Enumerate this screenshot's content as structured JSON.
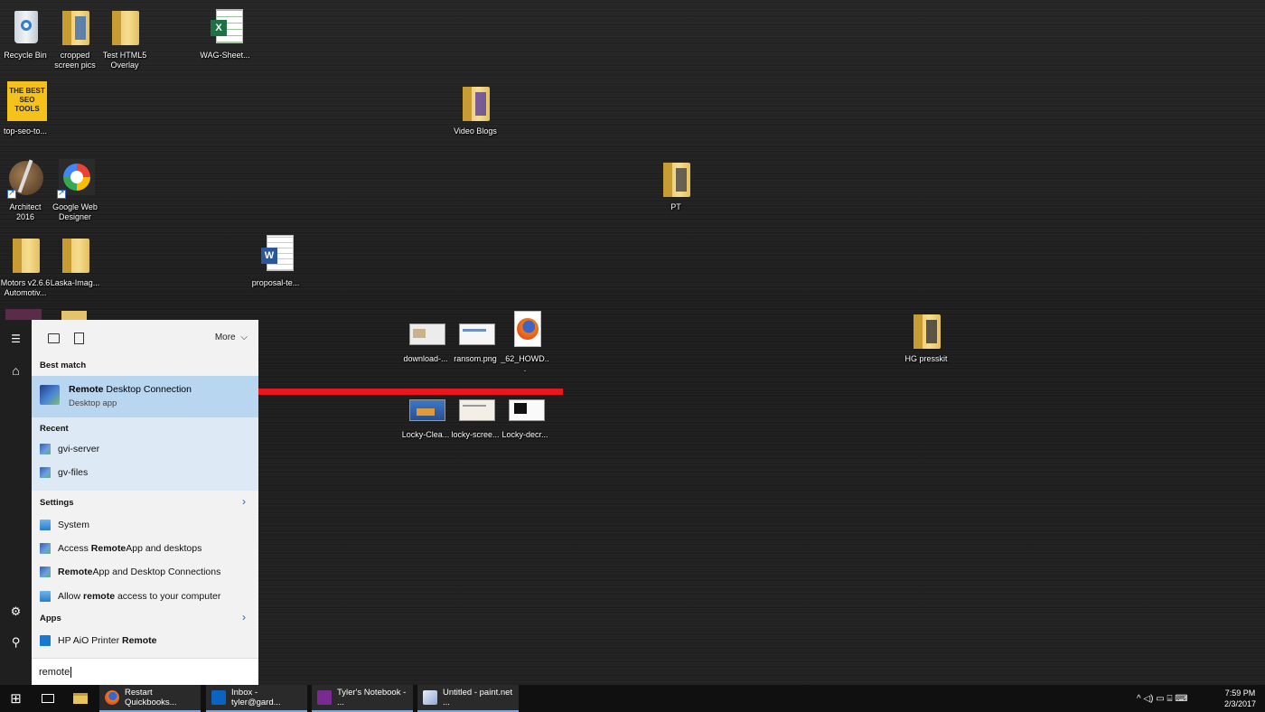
{
  "desktop": {
    "icons": [
      {
        "label": "Recycle Bin"
      },
      {
        "label": "cropped screen pics"
      },
      {
        "label": "Test HTML5 Overlay"
      },
      {
        "label": "WAG-Sheet..."
      },
      {
        "label": "top-seo-to..."
      },
      {
        "label": "Video Blogs"
      },
      {
        "label": "Architect 2016"
      },
      {
        "label": "Google Web Designer"
      },
      {
        "label": "PT"
      },
      {
        "label": "Motors v2.6.6 Automotiv..."
      },
      {
        "label": "Laska-Imag..."
      },
      {
        "label": "proposal-te..."
      },
      {
        "label": "download-..."
      },
      {
        "label": "ransom.png"
      },
      {
        "label": "_62_HOWD..."
      },
      {
        "label": "HG presskit"
      },
      {
        "label": "Locky-Clea..."
      },
      {
        "label": "locky-scree..."
      },
      {
        "label": "Locky-decr..."
      }
    ],
    "thumb_text": {
      "seo": "THE BEST SEO TOOLS",
      "excel": "X",
      "word": "W"
    }
  },
  "start_rail": {
    "menu_glyph": "☰",
    "home_glyph": "⌂",
    "settings_glyph": "⚙",
    "user_glyph": "⚲"
  },
  "search_panel": {
    "more_label": "More",
    "more_chevron": "⌵",
    "best_match_heading": "Best match",
    "best_match": {
      "title_bold": "Remote",
      "title_rest": " Desktop Connection",
      "subtitle": "Desktop app"
    },
    "recent_heading": "Recent",
    "recent": [
      {
        "label": "gvi-server"
      },
      {
        "label": "gv-files"
      }
    ],
    "settings_heading": "Settings",
    "settings": [
      {
        "pre": "System",
        "bold": "",
        "post": ""
      },
      {
        "pre": "Access ",
        "bold": "Remote",
        "post": "App and desktops"
      },
      {
        "pre": "",
        "bold": "Remote",
        "post": "App and Desktop Connections"
      },
      {
        "pre": "Allow ",
        "bold": "remote",
        "post": " access to your computer"
      }
    ],
    "apps_heading": "Apps",
    "apps": [
      {
        "pre": "HP AiO Printer ",
        "bold": "Remote",
        "post": ""
      }
    ],
    "chevron": "›",
    "query": "remote"
  },
  "taskbar": {
    "start_glyph": "⊞",
    "apps": [
      {
        "label": "Restart Quickbooks..."
      },
      {
        "label": "Inbox - tyler@gard..."
      },
      {
        "label": "Tyler's Notebook - ..."
      },
      {
        "label": "Untitled - paint.net ..."
      }
    ],
    "tray_glyphs": "^  ◁)  ▭  ⌸  ⌨",
    "time": "7:59 PM",
    "date": "2/3/2017"
  },
  "colors": {
    "arrow": "#e8171d",
    "highlight": "#b9d6f0",
    "recent_bg": "#dde9f5"
  }
}
